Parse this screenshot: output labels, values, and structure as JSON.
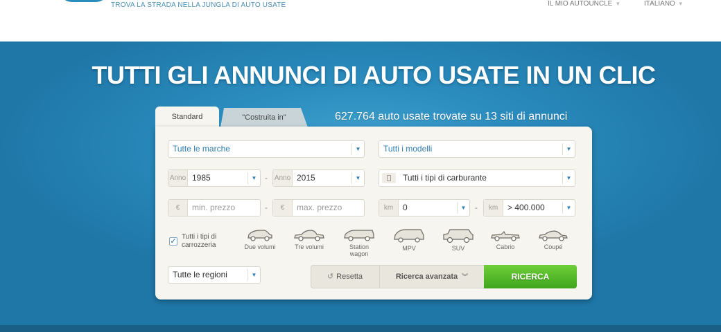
{
  "header": {
    "tagline": "TROVA LA STRADA NELLA JUNGLA DI AUTO USATE",
    "nav": [
      {
        "label": "IL MIO AUTOUNCLE"
      },
      {
        "label": "ITALIANO"
      }
    ]
  },
  "hero": {
    "title": "TUTTI GLI ANNUNCI DI AUTO USATE IN UN CLIC",
    "count_text": "627.764 auto usate trovate su 13 siti di annunci"
  },
  "tabs": [
    {
      "label": "Standard",
      "active": true
    },
    {
      "label": "\"Costruita in\"",
      "active": false
    }
  ],
  "form": {
    "make": {
      "value": "Tutte le marche"
    },
    "model": {
      "value": "Tutti i modelli"
    },
    "year_from": {
      "prefix": "Anno",
      "value": "1985"
    },
    "year_to": {
      "prefix": "Anno",
      "value": "2015"
    },
    "fuel": {
      "value": "Tutti i tipi di carburante"
    },
    "price_min": {
      "prefix": "€",
      "placeholder": "min. prezzo"
    },
    "price_max": {
      "prefix": "€",
      "placeholder": "max. prezzo"
    },
    "km_from": {
      "prefix": "km",
      "value": "0"
    },
    "km_to": {
      "prefix": "km",
      "value": "> 400.000"
    },
    "body_all": {
      "label": "Tutti i tipi di carrozzeria",
      "checked": true
    },
    "body_types": [
      {
        "label": "Due volumi"
      },
      {
        "label": "Tre volumi"
      },
      {
        "label": "Station wagon"
      },
      {
        "label": "MPV"
      },
      {
        "label": "SUV"
      },
      {
        "label": "Cabrio"
      },
      {
        "label": "Coupé"
      }
    ],
    "region": {
      "value": "Tutte le regioni"
    }
  },
  "actions": {
    "reset": "Resetta",
    "advanced": "Ricerca avanzata",
    "search": "RICERCA"
  },
  "colors": {
    "accent_blue": "#2a8cbd",
    "search_green": "#4fb826"
  }
}
